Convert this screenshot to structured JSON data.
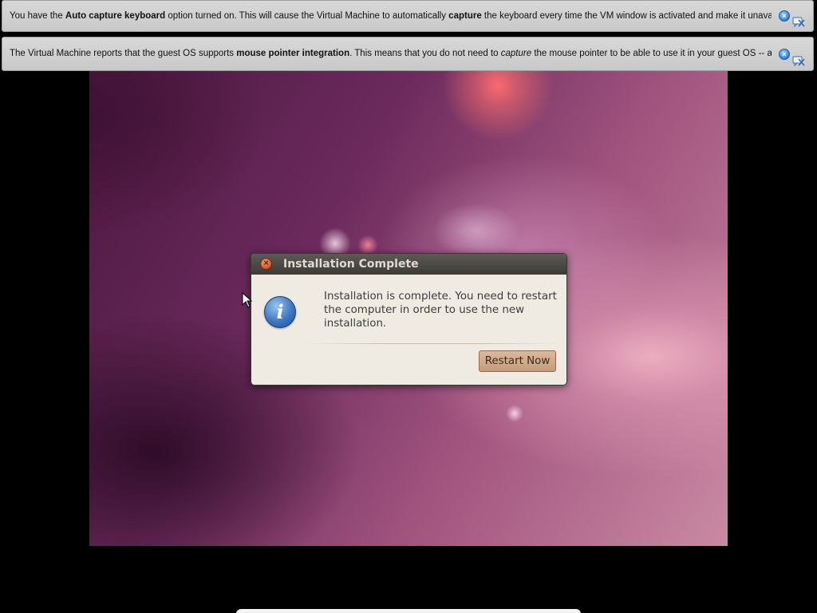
{
  "banners": [
    {
      "prefix": "You have the ",
      "bold1": "Auto capture keyboard",
      "middle": " option turned on. This will cause the Virtual Machine to automatically ",
      "bold2": "capture",
      "suffix": " the keyboard every time the VM window is activated and make it unavailable to"
    },
    {
      "prefix": "The Virtual Machine reports that the guest OS supports ",
      "bold1": "mouse pointer integration",
      "middle": ". This means that you do not need to ",
      "italic": "capture",
      "suffix": " the mouse pointer to be able to use it in your guest OS -- all mouse"
    }
  ],
  "dialog": {
    "title": "Installation Complete",
    "message": "Installation is complete. You need to restart the computer in order to use the new installation.",
    "button_label": "Restart Now",
    "icon_glyph": "i"
  },
  "icons": {
    "close_glyph": "×"
  }
}
